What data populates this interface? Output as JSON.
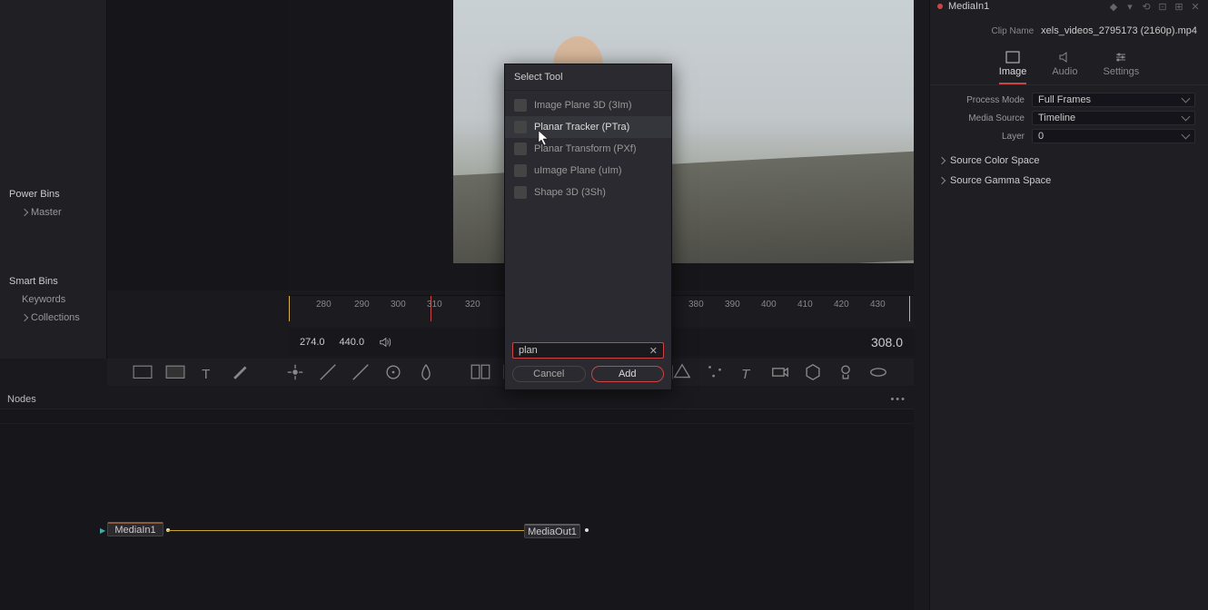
{
  "inspector": {
    "node_name": "MediaIn1",
    "clip_name_label": "Clip Name",
    "clip_name": "xels_videos_2795173 (2160p).mp4",
    "tabs": {
      "image": "Image",
      "audio": "Audio",
      "settings": "Settings"
    },
    "props": {
      "process_mode_label": "Process Mode",
      "process_mode": "Full Frames",
      "media_source_label": "Media Source",
      "media_source": "Timeline",
      "layer_label": "Layer",
      "layer": "0"
    },
    "collapse": {
      "source_color_space": "Source Color Space",
      "source_gamma_space": "Source Gamma Space"
    }
  },
  "bins": {
    "power_header": "Power Bins",
    "power_item": "Master",
    "smart_header": "Smart Bins",
    "smart_keywords": "Keywords",
    "smart_collections": "Collections"
  },
  "ruler": {
    "ticks": [
      "280",
      "290",
      "300",
      "310",
      "320",
      "380",
      "390",
      "400",
      "410",
      "420",
      "430"
    ]
  },
  "transport": {
    "in": "274.0",
    "out": "440.0",
    "current": "308.0"
  },
  "nodes": {
    "header": "Nodes",
    "media_in": "MediaIn1",
    "media_out": "MediaOut1"
  },
  "dialog": {
    "title": "Select Tool",
    "items": [
      "Image Plane 3D (3Im)",
      "Planar Tracker (PTra)",
      "Planar Transform (PXf)",
      "uImage Plane (uIm)",
      "Shape 3D (3Sh)"
    ],
    "search_value": "plan",
    "cancel": "Cancel",
    "add": "Add"
  }
}
